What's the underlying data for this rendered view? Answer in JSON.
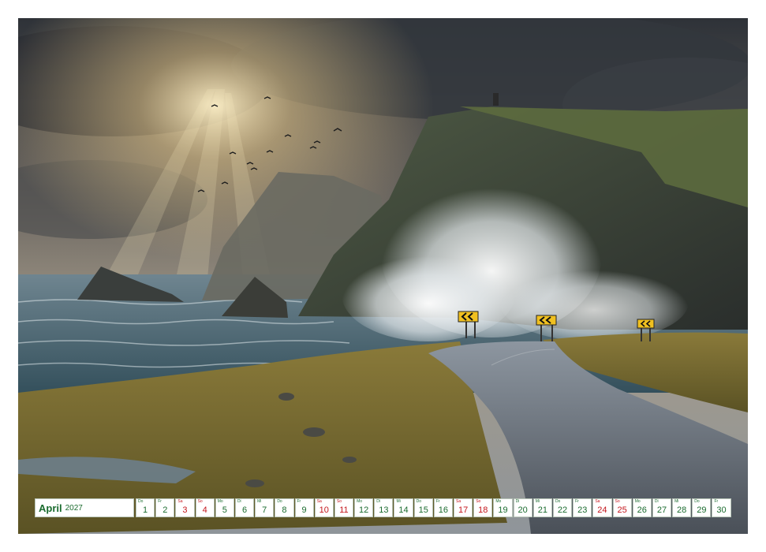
{
  "colors": {
    "weekday": "#1a6b2e",
    "weekend": "#c4161c",
    "border": "#b9c6b9"
  },
  "calendar": {
    "month": "April",
    "year": "2027",
    "days": [
      {
        "wd": "Do",
        "d": "1",
        "red": false
      },
      {
        "wd": "Fr",
        "d": "2",
        "red": false
      },
      {
        "wd": "Sa",
        "d": "3",
        "red": true
      },
      {
        "wd": "So",
        "d": "4",
        "red": true
      },
      {
        "wd": "Mo",
        "d": "5",
        "red": false
      },
      {
        "wd": "Di",
        "d": "6",
        "red": false
      },
      {
        "wd": "Mi",
        "d": "7",
        "red": false
      },
      {
        "wd": "Do",
        "d": "8",
        "red": false
      },
      {
        "wd": "Fr",
        "d": "9",
        "red": false
      },
      {
        "wd": "Sa",
        "d": "10",
        "red": true
      },
      {
        "wd": "So",
        "d": "11",
        "red": true
      },
      {
        "wd": "Mo",
        "d": "12",
        "red": false
      },
      {
        "wd": "Di",
        "d": "13",
        "red": false
      },
      {
        "wd": "Mi",
        "d": "14",
        "red": false
      },
      {
        "wd": "Do",
        "d": "15",
        "red": false
      },
      {
        "wd": "Fr",
        "d": "16",
        "red": false
      },
      {
        "wd": "Sa",
        "d": "17",
        "red": true
      },
      {
        "wd": "So",
        "d": "18",
        "red": true
      },
      {
        "wd": "Mo",
        "d": "19",
        "red": false
      },
      {
        "wd": "Di",
        "d": "20",
        "red": false
      },
      {
        "wd": "Mi",
        "d": "21",
        "red": false
      },
      {
        "wd": "Do",
        "d": "22",
        "red": false
      },
      {
        "wd": "Fr",
        "d": "23",
        "red": false
      },
      {
        "wd": "Sa",
        "d": "24",
        "red": true
      },
      {
        "wd": "So",
        "d": "25",
        "red": true
      },
      {
        "wd": "Mo",
        "d": "26",
        "red": false
      },
      {
        "wd": "Di",
        "d": "27",
        "red": false
      },
      {
        "wd": "Mi",
        "d": "28",
        "red": false
      },
      {
        "wd": "Do",
        "d": "29",
        "red": false
      },
      {
        "wd": "Fr",
        "d": "30",
        "red": false
      }
    ]
  }
}
